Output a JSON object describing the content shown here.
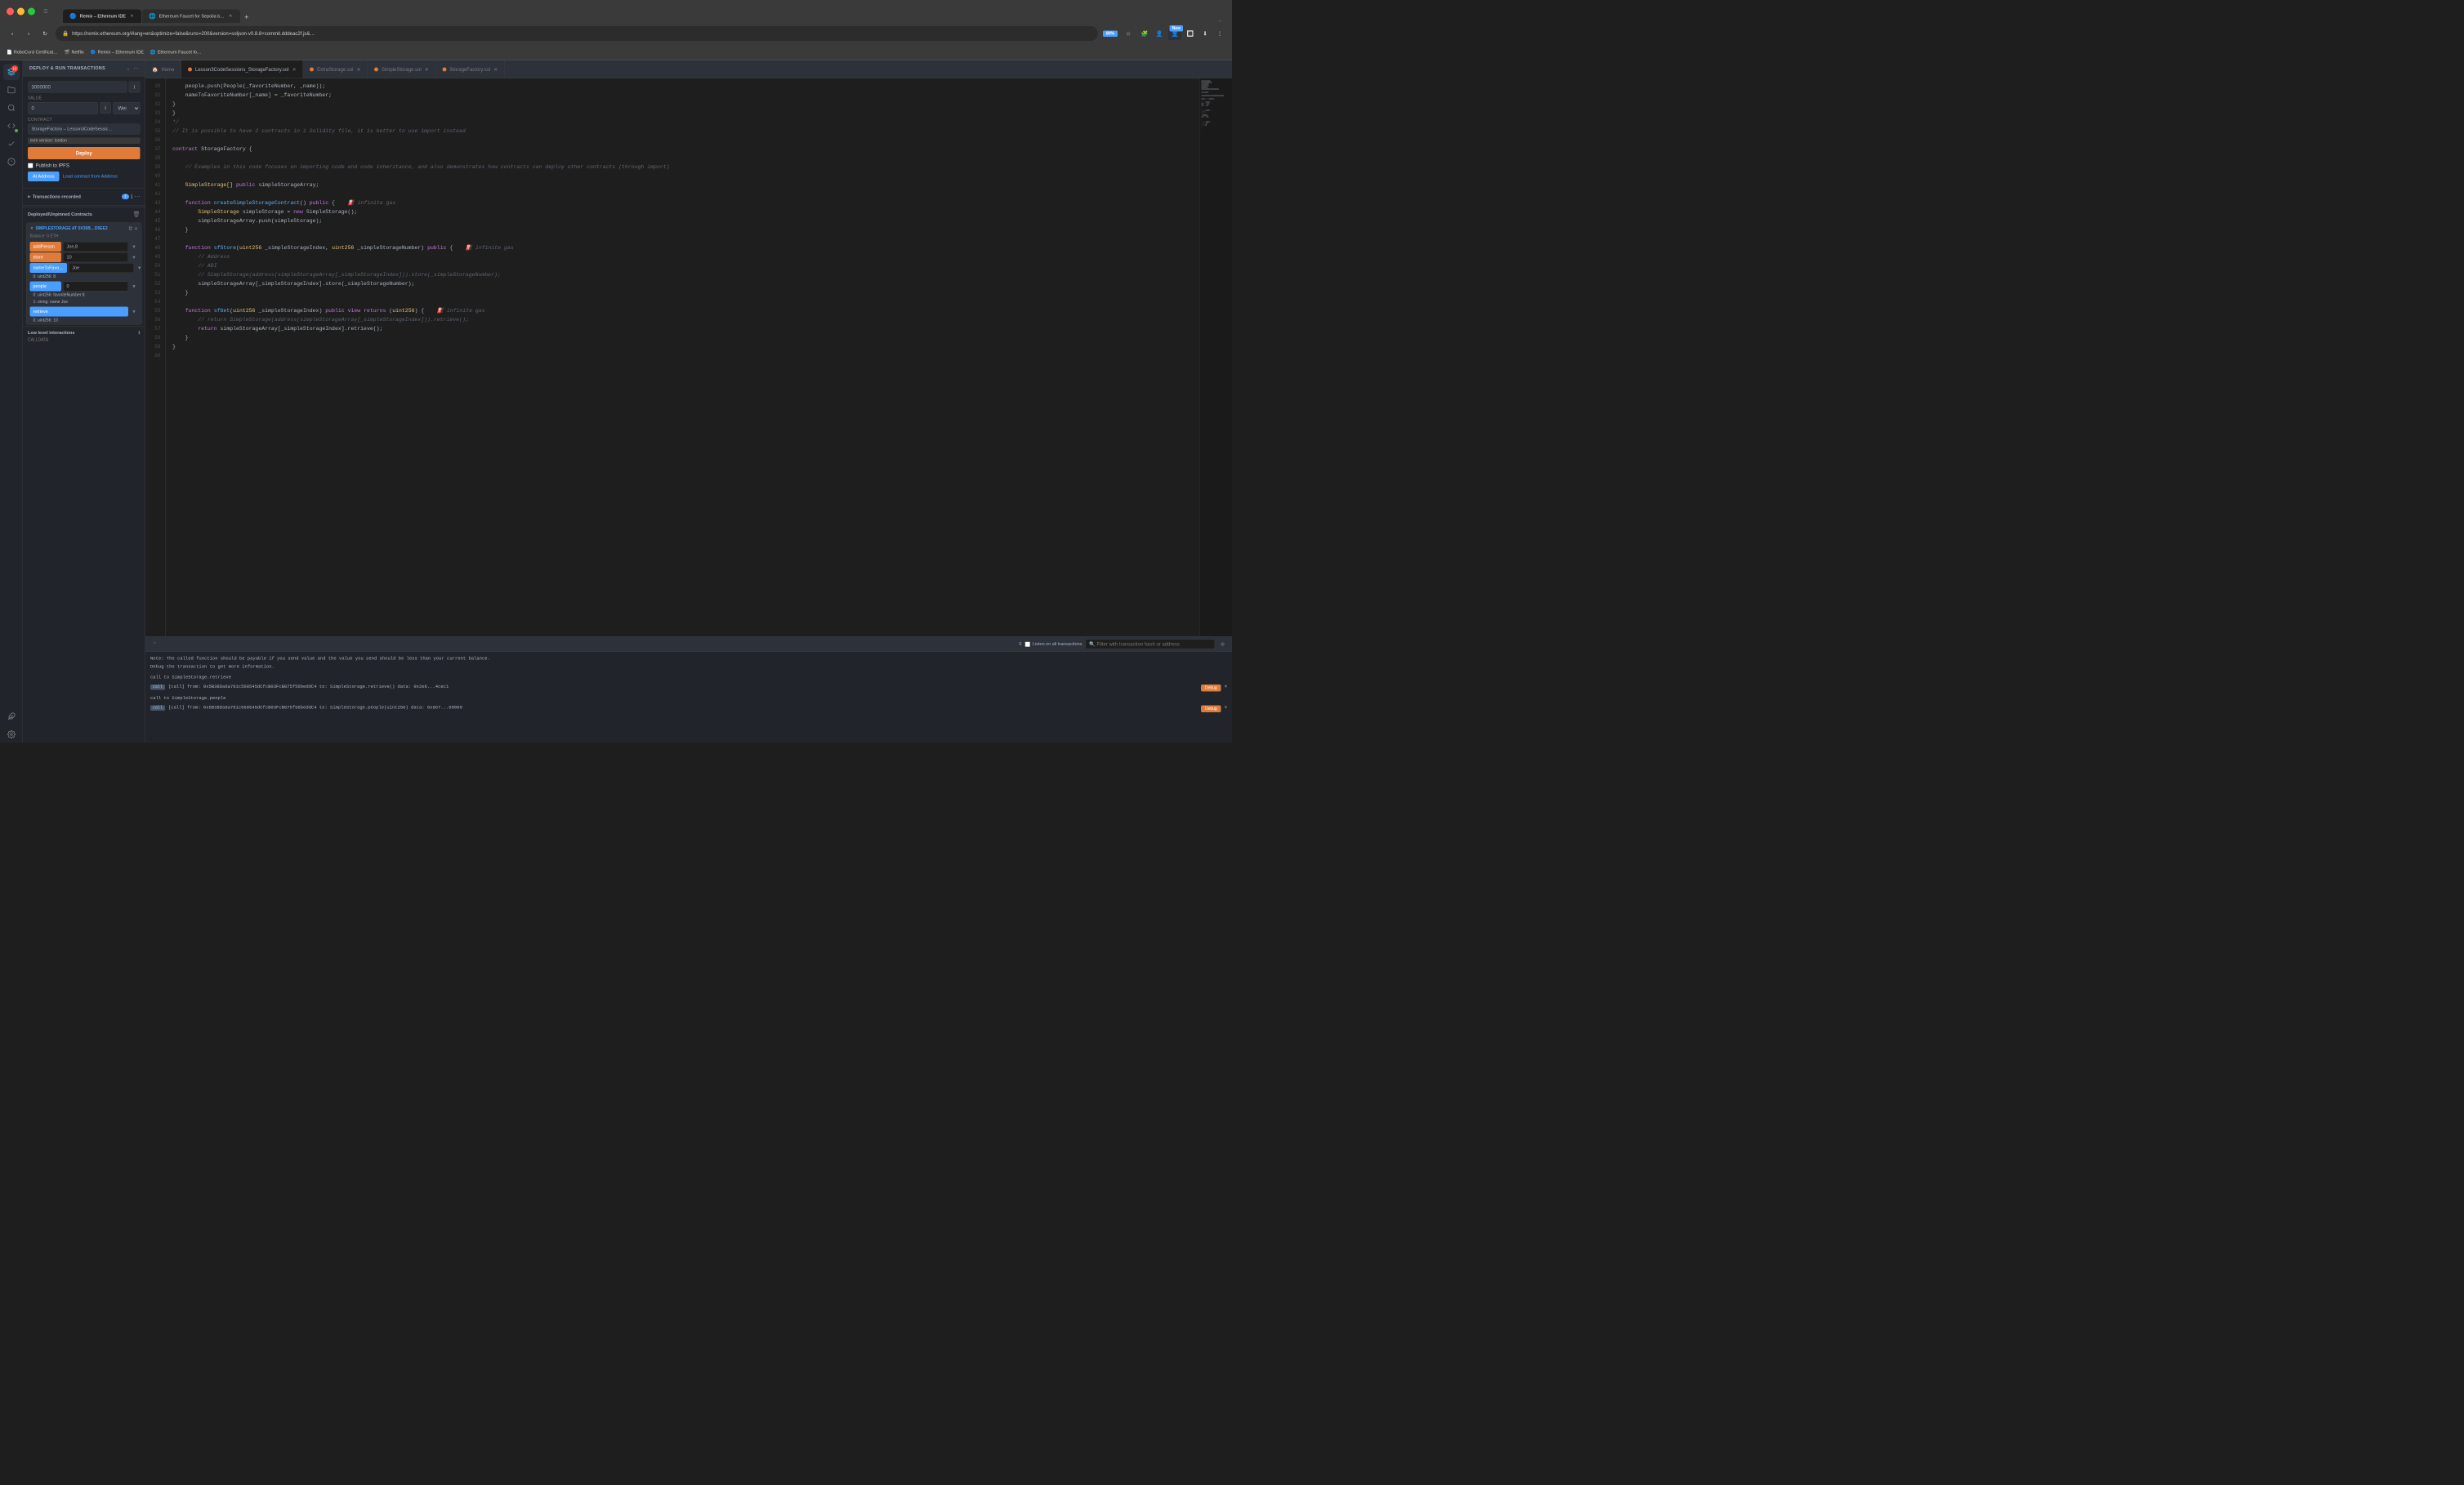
{
  "browser": {
    "tabs": [
      {
        "label": "Remix – Ethereum IDE",
        "active": true,
        "icon": "🔵"
      },
      {
        "label": "Ethereum Faucet for Sepolia b…",
        "active": false,
        "icon": "🌐"
      }
    ],
    "url": "https://remix.ethereum.org/#lang=en&optimize=false&runs=200&version=soljson-v0.8.8+commit.dddeac2f.js&…",
    "zoom": "80%",
    "bookmarks": [
      {
        "label": "RoboCord Certificat…"
      },
      {
        "label": "Netflix"
      },
      {
        "label": "Remix – Ethereum IDE"
      },
      {
        "label": "Ethereum Faucet fo…"
      }
    ]
  },
  "deploy_panel": {
    "title": "DEPLOY & RUN TRANSACTIONS",
    "gas_limit_label": "",
    "gas_limit_value": "3000000",
    "value_label": "VALUE",
    "value_amount": "0",
    "value_unit": "Wei",
    "contract_label": "CONTRACT",
    "contract_value": "StorageFactory – Lesson3CodeSessic…",
    "evm_badge": "evm version: london",
    "deploy_btn": "Deploy",
    "publish_ipfs": "Publish to IPFS",
    "at_address_btn": "At Address",
    "load_contract_btn": "Load contract from Address",
    "transactions_title": "Transactions recorded",
    "transactions_count": "7",
    "deployed_title": "Deployed/Unpinned Contracts",
    "contract_instance": "SIMPLESTORAGE AT 0X35B…D5EE3",
    "balance": "Balance: 0 ETH",
    "functions": [
      {
        "name": "addPerson",
        "value": "Joe,8",
        "type": "orange"
      },
      {
        "name": "store",
        "value": "10",
        "type": "orange"
      },
      {
        "name": "nameToFavo…",
        "value": "Joe",
        "type": "blue",
        "output": "0: uint256: 8"
      },
      {
        "name": "people",
        "value": "0",
        "type": "blue",
        "output1": "0: uint256: favoriteNumber 8",
        "output2": "1: string: name Joe"
      },
      {
        "name": "retrieve",
        "type": "blue",
        "output": "0: uint256: 10"
      }
    ],
    "low_level_title": "Low level interactions",
    "calldata_label": "CALLDATA"
  },
  "editor": {
    "toolbar_tabs": [
      {
        "label": "Home",
        "icon": "🏠"
      },
      {
        "label": "Lesson3CodeSessions_StorageFactory.sol",
        "active": true,
        "dot_color": "#e07b39"
      },
      {
        "label": "ExtraStorage.sol",
        "dot_color": "#e07b39"
      },
      {
        "label": "SimpleStorage.sol",
        "dot_color": "#e07b39"
      },
      {
        "label": "StorageFactory.sol",
        "dot_color": "#e07b39"
      }
    ],
    "lines": [
      {
        "num": 30,
        "code": "    people.push(People(_favoriteNumber, _name));",
        "tokens": [
          {
            "t": "plain",
            "v": "    people.push(People(_favoriteNumber, _name));"
          }
        ]
      },
      {
        "num": 31,
        "code": "    nameToFavoriteNumber[_name] = _favoriteNumber;",
        "tokens": [
          {
            "t": "plain",
            "v": "    nameToFavoriteNumber[_name] = _favoriteNumber;"
          }
        ]
      },
      {
        "num": 32,
        "code": "}",
        "tokens": [
          {
            "t": "plain",
            "v": "}"
          }
        ]
      },
      {
        "num": 33,
        "code": "}",
        "tokens": [
          {
            "t": "plain",
            "v": "}"
          }
        ]
      },
      {
        "num": 34,
        "code": "*/",
        "tokens": [
          {
            "t": "comment",
            "v": "*/"
          }
        ]
      },
      {
        "num": 35,
        "code": "// It is possible to have 2 contracts in 1 Solidity file, it is better to use import instead",
        "tokens": [
          {
            "t": "comment",
            "v": "// It is possible to have 2 contracts in 1 Solidity file, it is better to use import instead"
          }
        ]
      },
      {
        "num": 36,
        "code": "",
        "tokens": []
      },
      {
        "num": 37,
        "code": "contract StorageFactory {",
        "tokens": [
          {
            "t": "kw",
            "v": "contract"
          },
          {
            "t": "plain",
            "v": " StorageFactory {"
          }
        ]
      },
      {
        "num": 38,
        "code": "",
        "tokens": []
      },
      {
        "num": 39,
        "code": "    // Examples in this code focuses on importing code and code inheritance, and also demonstrates how contracts can deploy other contracts (through import)",
        "tokens": [
          {
            "t": "comment",
            "v": "    // Examples in this code focuses on importing code and code inheritance, and also demonstrates how contracts can deploy other contracts (through import)"
          }
        ]
      },
      {
        "num": 40,
        "code": "",
        "tokens": []
      },
      {
        "num": 41,
        "code": "    SimpleStorage[] public simpleStorageArray;",
        "tokens": [
          {
            "t": "type",
            "v": "    SimpleStorage[]"
          },
          {
            "t": "plain",
            "v": " "
          },
          {
            "t": "kw",
            "v": "public"
          },
          {
            "t": "plain",
            "v": " simpleStorageArray;"
          }
        ]
      },
      {
        "num": 42,
        "code": "",
        "tokens": []
      },
      {
        "num": 43,
        "code": "    function createSimpleStorageContract() public {    ⛽ infinite gas",
        "tokens": [
          {
            "t": "plain",
            "v": "    "
          },
          {
            "t": "kw",
            "v": "function"
          },
          {
            "t": "plain",
            "v": " "
          },
          {
            "t": "fn-name",
            "v": "createSimpleStorageContract"
          },
          {
            "t": "plain",
            "v": "() "
          },
          {
            "t": "kw",
            "v": "public"
          },
          {
            "t": "plain",
            "v": " {    "
          },
          {
            "t": "comment",
            "v": "⛽ infinite gas"
          }
        ]
      },
      {
        "num": 44,
        "code": "        SimpleStorage simpleStorage = new SimpleStorage();",
        "tokens": [
          {
            "t": "type",
            "v": "        SimpleStorage"
          },
          {
            "t": "plain",
            "v": " simpleStorage = "
          },
          {
            "t": "kw",
            "v": "new"
          },
          {
            "t": "plain",
            "v": " SimpleStorage();"
          }
        ]
      },
      {
        "num": 45,
        "code": "        simpleStorageArray.push(simpleStorage);",
        "tokens": [
          {
            "t": "plain",
            "v": "        simpleStorageArray.push(simpleStorage);"
          }
        ]
      },
      {
        "num": 46,
        "code": "    }",
        "tokens": [
          {
            "t": "plain",
            "v": "    }"
          }
        ]
      },
      {
        "num": 47,
        "code": "",
        "tokens": []
      },
      {
        "num": 48,
        "code": "    function sfStore(uint256 _simpleStorageIndex, uint256 _simpleStorageNumber) public {    ⛽ infinite gas",
        "tokens": [
          {
            "t": "plain",
            "v": "    "
          },
          {
            "t": "kw",
            "v": "function"
          },
          {
            "t": "plain",
            "v": " "
          },
          {
            "t": "fn-name",
            "v": "sfStore"
          },
          {
            "t": "plain",
            "v": "("
          },
          {
            "t": "type",
            "v": "uint256"
          },
          {
            "t": "plain",
            "v": " _simpleStorageIndex, "
          },
          {
            "t": "type",
            "v": "uint256"
          },
          {
            "t": "plain",
            "v": " _simpleStorageNumber) "
          },
          {
            "t": "kw",
            "v": "public"
          },
          {
            "t": "plain",
            "v": " {    "
          },
          {
            "t": "comment",
            "v": "⛽ infinite gas"
          }
        ]
      },
      {
        "num": 49,
        "code": "        // Address",
        "tokens": [
          {
            "t": "comment",
            "v": "        // Address"
          }
        ]
      },
      {
        "num": 50,
        "code": "        // ABI",
        "tokens": [
          {
            "t": "comment",
            "v": "        // ABI"
          }
        ]
      },
      {
        "num": 51,
        "code": "        // SimpleStorage(address(simpleStorageArray[_simpleStorageIndex])).store(_simpleStorageNumber);",
        "tokens": [
          {
            "t": "comment",
            "v": "        // SimpleStorage(address(simpleStorageArray[_simpleStorageIndex])).store(_simpleStorageNumber);"
          }
        ]
      },
      {
        "num": 52,
        "code": "        simpleStorageArray[_simpleStorageIndex].store(_simpleStorageNumber);",
        "tokens": [
          {
            "t": "plain",
            "v": "        simpleStorageArray[_simpleStorageIndex].store(_simpleStorageNumber);"
          }
        ]
      },
      {
        "num": 53,
        "code": "    }",
        "tokens": [
          {
            "t": "plain",
            "v": "    }"
          }
        ]
      },
      {
        "num": 54,
        "code": "",
        "tokens": []
      },
      {
        "num": 55,
        "code": "    function sfGet(uint256 _simpleStorageIndex) public view returns (uint256) {    ⛽ infinite gas",
        "tokens": [
          {
            "t": "plain",
            "v": "    "
          },
          {
            "t": "kw",
            "v": "function"
          },
          {
            "t": "plain",
            "v": " "
          },
          {
            "t": "fn-name",
            "v": "sfGet"
          },
          {
            "t": "plain",
            "v": "("
          },
          {
            "t": "type",
            "v": "uint256"
          },
          {
            "t": "plain",
            "v": " _simpleStorageIndex) "
          },
          {
            "t": "kw",
            "v": "public"
          },
          {
            "t": "plain",
            "v": " "
          },
          {
            "t": "kw",
            "v": "view"
          },
          {
            "t": "plain",
            "v": " "
          },
          {
            "t": "kw",
            "v": "returns"
          },
          {
            "t": "plain",
            "v": " ("
          },
          {
            "t": "type",
            "v": "uint256"
          },
          {
            "t": "plain",
            "v": ") {    "
          },
          {
            "t": "comment",
            "v": "⛽ infinite gas"
          }
        ]
      },
      {
        "num": 56,
        "code": "        // return SimpleStorage(address(simpleStorageArray[_simpleStorageIndex])).retrieve();",
        "tokens": [
          {
            "t": "comment",
            "v": "        // return SimpleStorage(address(simpleStorageArray[_simpleStorageIndex])).retrieve();"
          }
        ]
      },
      {
        "num": 57,
        "code": "        return simpleStorageArray[_simpleStorageIndex].retrieve();",
        "tokens": [
          {
            "t": "plain",
            "v": "        "
          },
          {
            "t": "kw",
            "v": "return"
          },
          {
            "t": "plain",
            "v": " simpleStorageArray[_simpleStorageIndex].retrieve();"
          }
        ]
      },
      {
        "num": 58,
        "code": "    }",
        "tokens": [
          {
            "t": "plain",
            "v": "    }"
          }
        ]
      },
      {
        "num": 59,
        "code": "}",
        "tokens": [
          {
            "t": "plain",
            "v": "}"
          }
        ]
      },
      {
        "num": 60,
        "code": "",
        "tokens": []
      }
    ]
  },
  "terminal": {
    "note": "Note: The called function should be payable if you send value and the value you send should be less than your current balance.",
    "note2": "Debug the transaction to get more information.",
    "line1": "call to SimpleStorage.retrieve",
    "call1": "[call] from: 0x5B38Da6a701c568545dCfcB03FcB875f56beddC4 to: SimpleStorage.retrieve() data: 0x2e6...4cec1",
    "line2": "call to SimpleStorage.people",
    "call2": "[call] from: 0x5B38Da6a701c568545dCfcB03FcB875f56beddC4 to: SimpleStorage.people(uint256) data: 0x9e7...00000",
    "search_placeholder": "Filter with transaction hash or address",
    "counter": "0",
    "listen_label": "Listen on all transactions"
  },
  "icons": {
    "deploy": "🚀",
    "search": "🔍",
    "file": "📄",
    "compile": "⚙️",
    "test": "✓",
    "debug": "🐛",
    "plugin": "🔌",
    "settings": "⚙️",
    "git": "📦",
    "chevron_down": "▼",
    "chevron_right": "▶",
    "copy": "⧉",
    "close": "✕",
    "trash": "🗑",
    "info": "ℹ",
    "refresh": "↻",
    "star": "☆",
    "shield": "🛡",
    "new": "New"
  }
}
